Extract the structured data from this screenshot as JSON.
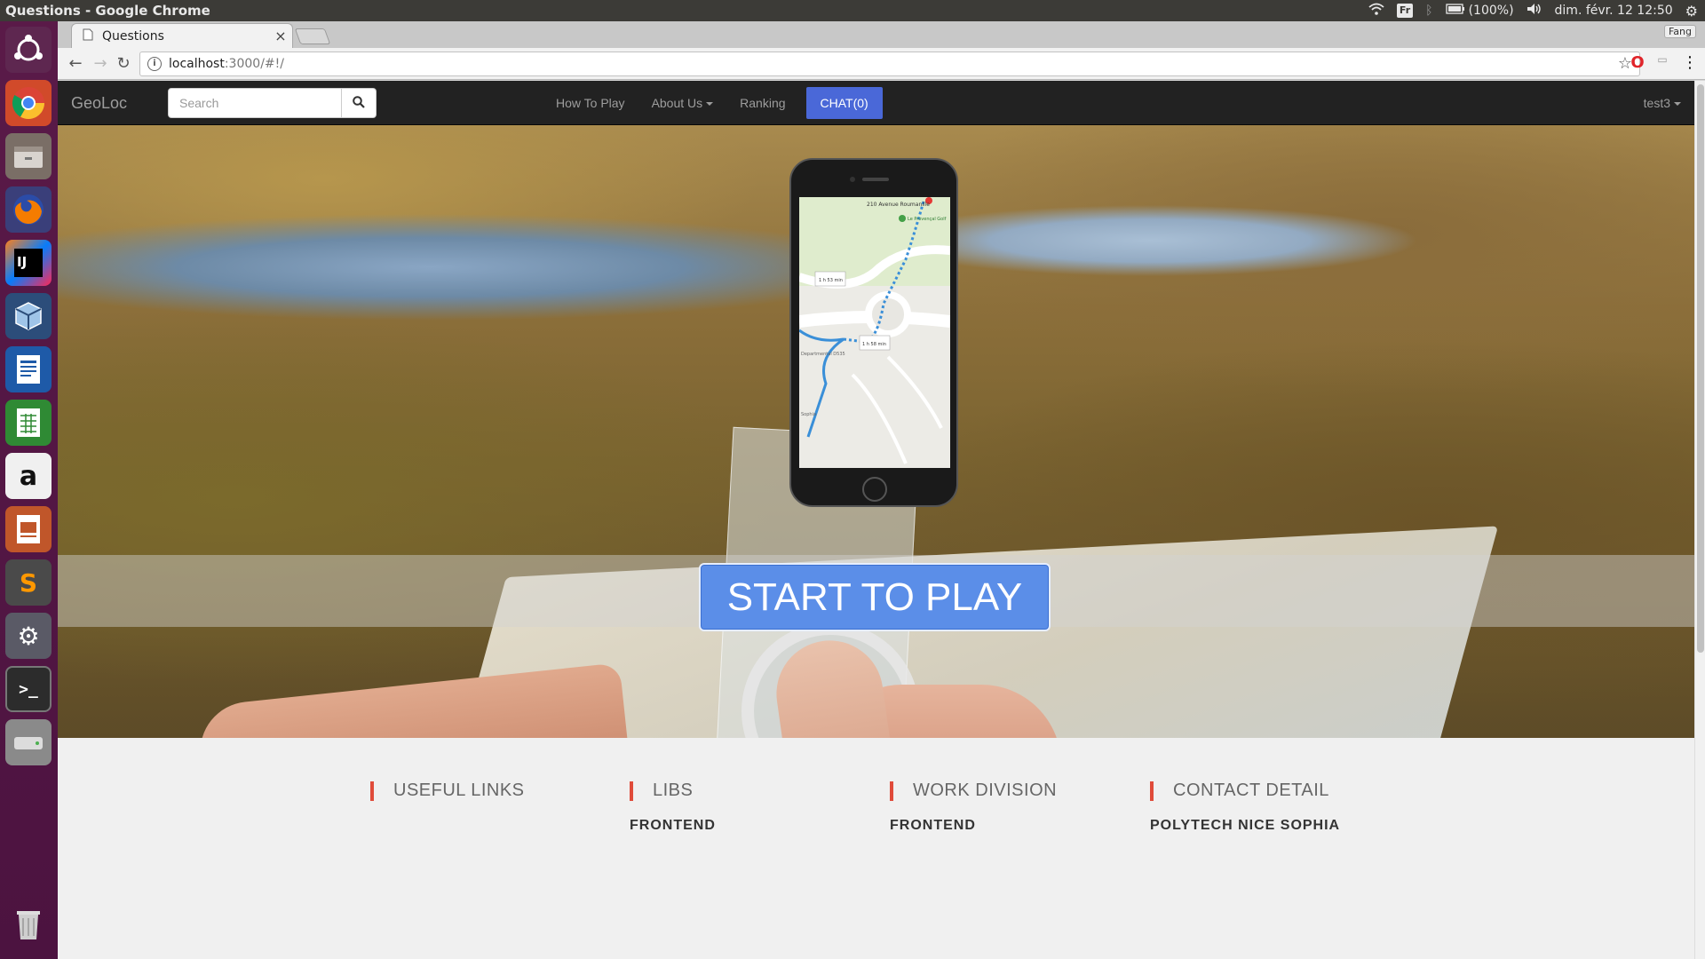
{
  "window": {
    "title": "Questions - Google Chrome"
  },
  "indicators": {
    "keyboard_lang": "Fr",
    "battery": "(100%)",
    "datetime": "dim. févr. 12 12:50"
  },
  "launcher": {
    "icons": [
      "ubuntu-dash-icon",
      "chrome-icon",
      "files-icon",
      "firefox-icon",
      "intellij-icon",
      "virtualbox-icon",
      "writer-icon",
      "calc-icon",
      "amazon-icon",
      "impress-icon",
      "sublime-icon",
      "settings-icon",
      "terminal-icon",
      "drive-icon",
      "trash-icon"
    ]
  },
  "browser": {
    "tab_title": "Questions",
    "tab_close": "×",
    "profile_label": "Fang",
    "url_host": "localhost",
    "url_rest": ":3000/#!/"
  },
  "navbar": {
    "brand": "GeoLoc",
    "search_placeholder": "Search",
    "links": {
      "how_to_play": "How To Play",
      "about_us": "About Us",
      "ranking": "Ranking",
      "chat": "CHAT(0)"
    },
    "user": "test3"
  },
  "hero": {
    "cta_label": "START TO PLAY",
    "phone_map": {
      "street": "210 Avenue Roumanille",
      "poi": "Le Provençal Golf",
      "time1": "1 h 53 min",
      "time2": "1 h 58 min",
      "road": "Departmental D535",
      "town": "Sophia"
    }
  },
  "footer": {
    "columns": [
      "USEFUL LINKS",
      "LIBS",
      "WORK DIVISION",
      "CONTACT DETAIL"
    ],
    "subheads": [
      "FRONTEND",
      "FRONTEND",
      "POLYTECH NICE SOPHIA"
    ]
  }
}
